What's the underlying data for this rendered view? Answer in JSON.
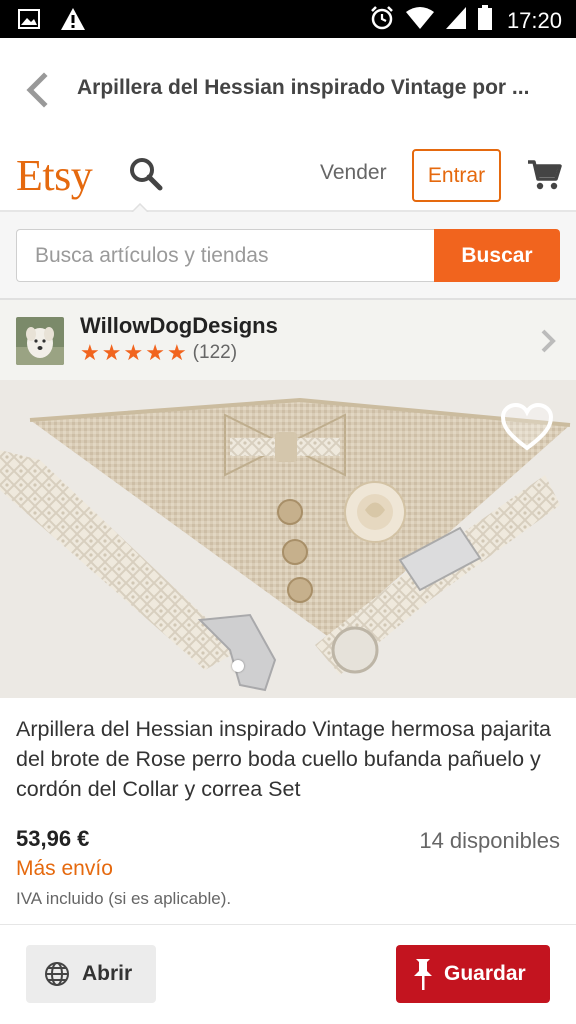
{
  "status_bar": {
    "time": "17:20",
    "icons": [
      "image-icon",
      "warning-icon",
      "alarm-icon",
      "wifi-icon",
      "signal-icon",
      "battery-icon"
    ]
  },
  "nav": {
    "title": "Arpillera del Hessian inspirado Vintage por ..."
  },
  "header": {
    "logo": "Etsy",
    "sell_label": "Vender",
    "signin_label": "Entrar",
    "brand_color": "#e5690e"
  },
  "search": {
    "placeholder": "Busca artículos y tiendas",
    "button_label": "Buscar",
    "button_color": "#f1641e"
  },
  "shop": {
    "name": "WillowDogDesigns",
    "rating_stars": 5,
    "review_count": "(122)"
  },
  "product": {
    "title": "Arpillera del Hessian inspirado Vintage hermosa pajarita del brote de Rose perro boda cuello bufanda pañuelo y cordón del Collar y correa Set",
    "price": "53,96 €",
    "availability": "14 disponibles",
    "shipping": "Más envío",
    "vat_note": "IVA incluido (si es aplicable).",
    "image_index": 1
  },
  "actions": {
    "open_label": "Abrir",
    "save_label": "Guardar",
    "save_color": "#c3141f"
  }
}
